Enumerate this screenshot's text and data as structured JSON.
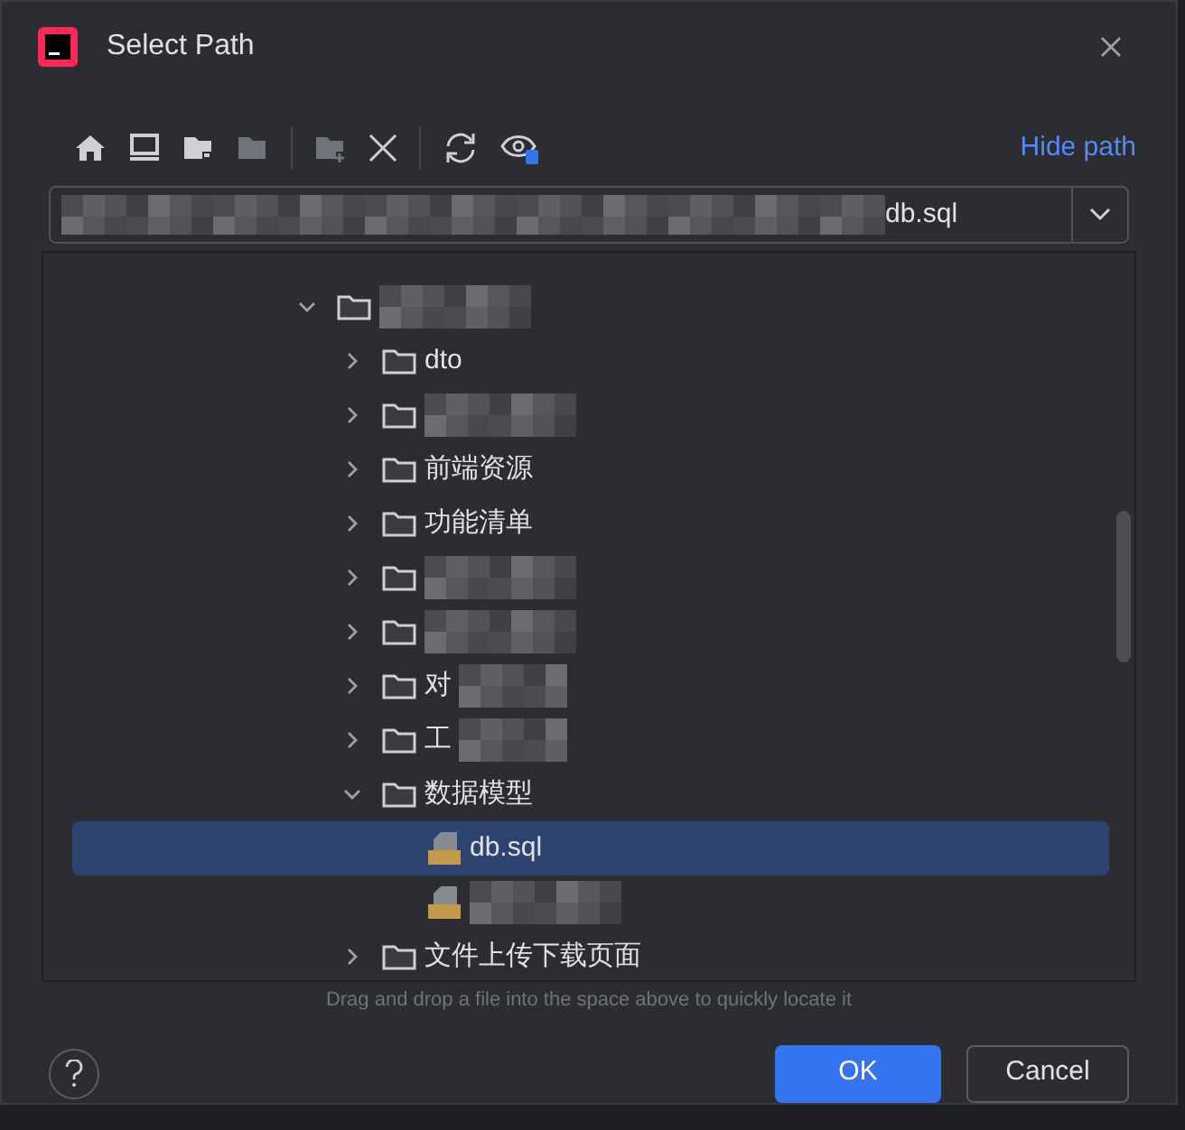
{
  "window": {
    "title": "Select Path"
  },
  "toolbar": {
    "hide_path_link": "Hide path"
  },
  "path_field": {
    "value": "db.sql",
    "blurred": true
  },
  "tree": [
    {
      "blurred": true,
      "kind": "folder",
      "expanded": true,
      "selected": false,
      "children": [
        {
          "label": "dto",
          "kind": "folder",
          "expanded": false,
          "selected": false,
          "blurred": false
        },
        {
          "kind": "folder",
          "expanded": false,
          "selected": false,
          "blurred": true
        },
        {
          "label": "前端资源",
          "kind": "folder",
          "expanded": false,
          "selected": false,
          "blurred": false
        },
        {
          "label": "功能清单",
          "kind": "folder",
          "expanded": false,
          "selected": false,
          "blurred": false
        },
        {
          "kind": "folder",
          "expanded": false,
          "selected": false,
          "blurred": true
        },
        {
          "kind": "folder",
          "expanded": false,
          "selected": false,
          "blurred": true
        },
        {
          "label": "对",
          "kind": "folder",
          "expanded": false,
          "selected": false,
          "blurred": true
        },
        {
          "label": "工",
          "kind": "folder",
          "expanded": false,
          "selected": false,
          "blurred": true
        },
        {
          "label": "数据模型",
          "kind": "folder",
          "expanded": true,
          "selected": false,
          "blurred": false,
          "children": [
            {
              "label": "db.sql",
              "kind": "sql",
              "selected": true,
              "blurred": false
            },
            {
              "kind": "sql",
              "selected": false,
              "blurred": true
            }
          ]
        },
        {
          "label": "文件上传下载页面",
          "kind": "folder",
          "expanded": false,
          "selected": false,
          "blurred": false
        }
      ]
    }
  ],
  "hint": "Drag and drop a file into the space above to quickly locate it",
  "buttons": [
    {
      "label": "OK",
      "kind": "primary"
    },
    {
      "label": "Cancel",
      "kind": "secondary"
    }
  ]
}
